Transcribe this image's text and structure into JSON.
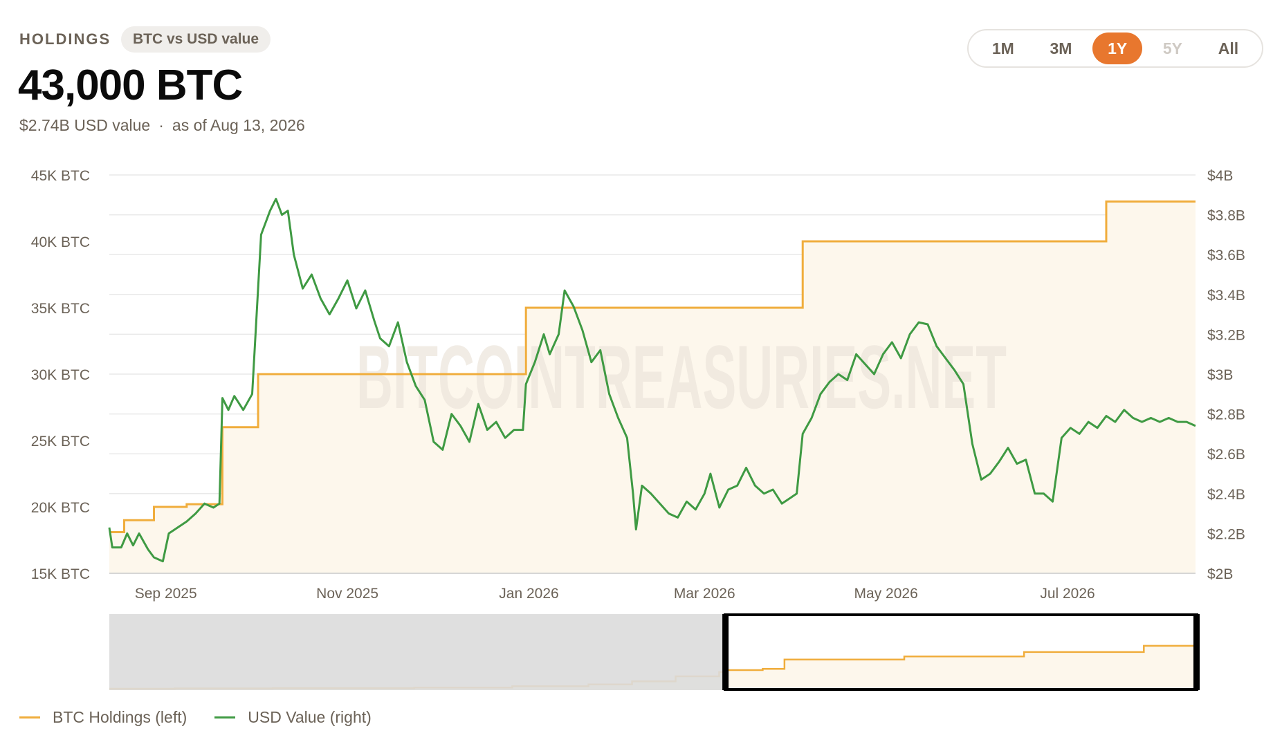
{
  "header": {
    "label": "HOLDINGS",
    "badge": "BTC vs USD value",
    "value": "43,000 BTC",
    "usd_value": "$2.74B USD value",
    "separator": "·",
    "as_of": "as of Aug 13, 2026"
  },
  "ranges": [
    {
      "label": "1M",
      "state": "normal"
    },
    {
      "label": "3M",
      "state": "normal"
    },
    {
      "label": "1Y",
      "state": "active"
    },
    {
      "label": "5Y",
      "state": "disabled"
    },
    {
      "label": "All",
      "state": "normal"
    }
  ],
  "watermark": "BITCOINTREASURIES.NET",
  "colors": {
    "btc": "#f0ad3c",
    "usd": "#3f9a43",
    "area": "#fdf7ec",
    "accent": "#e8772e",
    "grid": "#e9e9e9",
    "axis_text": "#6b6257",
    "navigator_mask": "#dcdcdc"
  },
  "chart_data": {
    "type": "line",
    "x_range": [
      "2025-08-13",
      "2026-08-13"
    ],
    "x_ticks": [
      {
        "date": "2025-09-01",
        "label": "Sep 2025"
      },
      {
        "date": "2025-11-01",
        "label": "Nov 2025"
      },
      {
        "date": "2026-01-01",
        "label": "Jan 2026"
      },
      {
        "date": "2026-03-01",
        "label": "Mar 2026"
      },
      {
        "date": "2026-05-01",
        "label": "May 2026"
      },
      {
        "date": "2026-07-01",
        "label": "Jul 2026"
      }
    ],
    "y_left": {
      "range": [
        15000,
        45000
      ],
      "ticks": [
        {
          "value": 15000,
          "label": "15K BTC"
        },
        {
          "value": 20000,
          "label": "20K BTC"
        },
        {
          "value": 25000,
          "label": "25K BTC"
        },
        {
          "value": 30000,
          "label": "30K BTC"
        },
        {
          "value": 35000,
          "label": "35K BTC"
        },
        {
          "value": 40000,
          "label": "40K BTC"
        },
        {
          "value": 45000,
          "label": "45K BTC"
        }
      ]
    },
    "y_right": {
      "range": [
        2.0,
        4.0
      ],
      "ticks": [
        {
          "value": 2.0,
          "label": "$2B"
        },
        {
          "value": 2.2,
          "label": "$2.2B"
        },
        {
          "value": 2.4,
          "label": "$2.4B"
        },
        {
          "value": 2.6,
          "label": "$2.6B"
        },
        {
          "value": 2.8,
          "label": "$2.8B"
        },
        {
          "value": 3.0,
          "label": "$3B"
        },
        {
          "value": 3.2,
          "label": "$3.2B"
        },
        {
          "value": 3.4,
          "label": "$3.4B"
        },
        {
          "value": 3.6,
          "label": "$3.6B"
        },
        {
          "value": 3.8,
          "label": "$3.8B"
        },
        {
          "value": 4.0,
          "label": "$4B"
        }
      ]
    },
    "grid": true,
    "series": [
      {
        "name": "BTC Holdings (left)",
        "axis": "left",
        "shape": "step",
        "points": [
          [
            "2025-08-13",
            18100
          ],
          [
            "2025-08-18",
            19000
          ],
          [
            "2025-08-28",
            20000
          ],
          [
            "2025-09-08",
            20200
          ],
          [
            "2025-09-20",
            26000
          ],
          [
            "2025-10-02",
            30000
          ],
          [
            "2025-12-31",
            35000
          ],
          [
            "2026-04-03",
            40000
          ],
          [
            "2026-07-14",
            43000
          ],
          [
            "2026-08-13",
            43000
          ]
        ]
      },
      {
        "name": "USD Value (right)",
        "axis": "right",
        "shape": "line",
        "points": [
          [
            "2025-08-13",
            2.23
          ],
          [
            "2025-08-14",
            2.13
          ],
          [
            "2025-08-17",
            2.13
          ],
          [
            "2025-08-19",
            2.2
          ],
          [
            "2025-08-21",
            2.14
          ],
          [
            "2025-08-23",
            2.2
          ],
          [
            "2025-08-26",
            2.12
          ],
          [
            "2025-08-28",
            2.08
          ],
          [
            "2025-08-31",
            2.06
          ],
          [
            "2025-09-02",
            2.2
          ],
          [
            "2025-09-05",
            2.23
          ],
          [
            "2025-09-08",
            2.26
          ],
          [
            "2025-09-11",
            2.3
          ],
          [
            "2025-09-14",
            2.35
          ],
          [
            "2025-09-17",
            2.33
          ],
          [
            "2025-09-19",
            2.35
          ],
          [
            "2025-09-20",
            2.88
          ],
          [
            "2025-09-22",
            2.82
          ],
          [
            "2025-09-24",
            2.89
          ],
          [
            "2025-09-27",
            2.82
          ],
          [
            "2025-09-30",
            2.9
          ],
          [
            "2025-10-03",
            3.7
          ],
          [
            "2025-10-06",
            3.82
          ],
          [
            "2025-10-08",
            3.88
          ],
          [
            "2025-10-10",
            3.8
          ],
          [
            "2025-10-12",
            3.82
          ],
          [
            "2025-10-14",
            3.6
          ],
          [
            "2025-10-17",
            3.43
          ],
          [
            "2025-10-20",
            3.5
          ],
          [
            "2025-10-23",
            3.38
          ],
          [
            "2025-10-26",
            3.3
          ],
          [
            "2025-10-29",
            3.38
          ],
          [
            "2025-11-01",
            3.47
          ],
          [
            "2025-11-04",
            3.33
          ],
          [
            "2025-11-07",
            3.42
          ],
          [
            "2025-11-10",
            3.27
          ],
          [
            "2025-11-12",
            3.18
          ],
          [
            "2025-11-15",
            3.14
          ],
          [
            "2025-11-18",
            3.26
          ],
          [
            "2025-11-21",
            3.06
          ],
          [
            "2025-11-24",
            2.94
          ],
          [
            "2025-11-27",
            2.87
          ],
          [
            "2025-11-30",
            2.66
          ],
          [
            "2025-12-03",
            2.62
          ],
          [
            "2025-12-06",
            2.8
          ],
          [
            "2025-12-09",
            2.74
          ],
          [
            "2025-12-12",
            2.66
          ],
          [
            "2025-12-15",
            2.85
          ],
          [
            "2025-12-18",
            2.72
          ],
          [
            "2025-12-21",
            2.76
          ],
          [
            "2025-12-24",
            2.68
          ],
          [
            "2025-12-27",
            2.72
          ],
          [
            "2025-12-30",
            2.72
          ],
          [
            "2025-12-31",
            2.95
          ],
          [
            "2026-01-03",
            3.06
          ],
          [
            "2026-01-06",
            3.2
          ],
          [
            "2026-01-08",
            3.1
          ],
          [
            "2026-01-11",
            3.2
          ],
          [
            "2026-01-13",
            3.42
          ],
          [
            "2026-01-16",
            3.34
          ],
          [
            "2026-01-19",
            3.22
          ],
          [
            "2026-01-22",
            3.06
          ],
          [
            "2026-01-25",
            3.12
          ],
          [
            "2026-01-28",
            2.9
          ],
          [
            "2026-01-31",
            2.78
          ],
          [
            "2026-02-03",
            2.68
          ],
          [
            "2026-02-05",
            2.4
          ],
          [
            "2026-02-06",
            2.22
          ],
          [
            "2026-02-08",
            2.44
          ],
          [
            "2026-02-11",
            2.4
          ],
          [
            "2026-02-14",
            2.35
          ],
          [
            "2026-02-17",
            2.3
          ],
          [
            "2026-02-20",
            2.28
          ],
          [
            "2026-02-23",
            2.36
          ],
          [
            "2026-02-26",
            2.32
          ],
          [
            "2026-03-01",
            2.4
          ],
          [
            "2026-03-03",
            2.5
          ],
          [
            "2026-03-06",
            2.33
          ],
          [
            "2026-03-09",
            2.42
          ],
          [
            "2026-03-12",
            2.44
          ],
          [
            "2026-03-15",
            2.53
          ],
          [
            "2026-03-18",
            2.44
          ],
          [
            "2026-03-21",
            2.4
          ],
          [
            "2026-03-24",
            2.42
          ],
          [
            "2026-03-27",
            2.35
          ],
          [
            "2026-03-30",
            2.38
          ],
          [
            "2026-04-01",
            2.4
          ],
          [
            "2026-04-03",
            2.7
          ],
          [
            "2026-04-06",
            2.78
          ],
          [
            "2026-04-09",
            2.9
          ],
          [
            "2026-04-12",
            2.96
          ],
          [
            "2026-04-15",
            3.0
          ],
          [
            "2026-04-18",
            2.97
          ],
          [
            "2026-04-21",
            3.1
          ],
          [
            "2026-04-24",
            3.05
          ],
          [
            "2026-04-27",
            3.0
          ],
          [
            "2026-04-30",
            3.1
          ],
          [
            "2026-05-03",
            3.16
          ],
          [
            "2026-05-06",
            3.08
          ],
          [
            "2026-05-09",
            3.2
          ],
          [
            "2026-05-12",
            3.26
          ],
          [
            "2026-05-15",
            3.25
          ],
          [
            "2026-05-18",
            3.14
          ],
          [
            "2026-05-21",
            3.08
          ],
          [
            "2026-05-24",
            3.02
          ],
          [
            "2026-05-27",
            2.95
          ],
          [
            "2026-05-30",
            2.65
          ],
          [
            "2026-06-02",
            2.47
          ],
          [
            "2026-06-05",
            2.5
          ],
          [
            "2026-06-08",
            2.56
          ],
          [
            "2026-06-11",
            2.63
          ],
          [
            "2026-06-14",
            2.55
          ],
          [
            "2026-06-17",
            2.57
          ],
          [
            "2026-06-20",
            2.4
          ],
          [
            "2026-06-23",
            2.4
          ],
          [
            "2026-06-26",
            2.36
          ],
          [
            "2026-06-29",
            2.68
          ],
          [
            "2026-07-02",
            2.73
          ],
          [
            "2026-07-05",
            2.7
          ],
          [
            "2026-07-08",
            2.76
          ],
          [
            "2026-07-11",
            2.73
          ],
          [
            "2026-07-14",
            2.79
          ],
          [
            "2026-07-17",
            2.76
          ],
          [
            "2026-07-20",
            2.82
          ],
          [
            "2026-07-23",
            2.78
          ],
          [
            "2026-07-26",
            2.76
          ],
          [
            "2026-07-29",
            2.78
          ],
          [
            "2026-08-01",
            2.76
          ],
          [
            "2026-08-04",
            2.78
          ],
          [
            "2026-08-07",
            2.76
          ],
          [
            "2026-08-10",
            2.76
          ],
          [
            "2026-08-13",
            2.74
          ]
        ]
      }
    ],
    "navigator": {
      "holdings_points": [
        [
          0.0,
          0.0
        ],
        [
          0.06,
          0.005
        ],
        [
          0.15,
          0.01
        ],
        [
          0.28,
          0.02
        ],
        [
          0.37,
          0.04
        ],
        [
          0.44,
          0.07
        ],
        [
          0.48,
          0.12
        ],
        [
          0.52,
          0.2
        ],
        [
          0.56,
          0.27
        ],
        [
          0.565,
          0.3
        ],
        [
          0.6,
          0.32
        ],
        [
          0.62,
          0.47
        ],
        [
          0.73,
          0.52
        ],
        [
          0.84,
          0.59
        ],
        [
          0.95,
          0.69
        ],
        [
          1.0,
          0.69
        ]
      ],
      "window": [
        0.5655,
        1.0
      ]
    }
  },
  "legend": [
    {
      "label": "BTC Holdings (left)",
      "color": "#f0ad3c"
    },
    {
      "label": "USD Value (right)",
      "color": "#3f9a43"
    }
  ]
}
